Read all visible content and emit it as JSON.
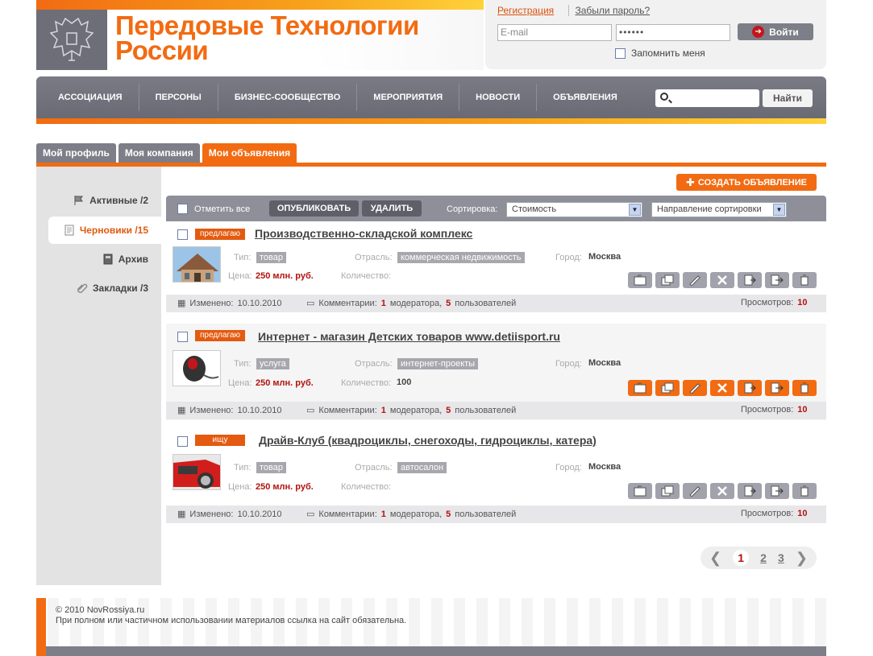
{
  "brand": {
    "logo_text": "Передовые Технологии России"
  },
  "login": {
    "register": "Регистрация",
    "forgot": "Забыли пароль?",
    "email_placeholder": "E-mail",
    "password_value": "••••••",
    "submit": "Войти",
    "remember": "Запомнить меня"
  },
  "nav": {
    "items": [
      "АССОЦИАЦИЯ",
      "ПЕРСОНЫ",
      "БИЗНЕС-СООБЩЕСТВО",
      "МЕРОПРИЯТИЯ",
      "НОВОСТИ",
      "ОБЪЯВЛЕНИЯ"
    ],
    "search_button": "Найти"
  },
  "tabs": [
    "Мой профиль",
    "Моя компания",
    "Мои объявления"
  ],
  "sidebar": [
    {
      "label": "Активные /2",
      "icon": "flag-icon"
    },
    {
      "label": "Черновики /15",
      "icon": "notepad-icon"
    },
    {
      "label": "Архив",
      "icon": "book-icon"
    },
    {
      "label": "Закладки /3",
      "icon": "paperclip-icon"
    }
  ],
  "toolbar": {
    "create": "СОЗДАТЬ ОБЪЯВЛЕНИЕ",
    "mark_all": "Отметить все",
    "publish": "ОПУБЛИКОВАТЬ",
    "delete": "УДАЛИТЬ",
    "sort_label": "Сортировка:",
    "sort_value": "Стоимость",
    "direction_value": "Направление сортировки"
  },
  "labels": {
    "type": "Тип:",
    "industry": "Отрасль:",
    "city": "Город:",
    "price": "Цена:",
    "quantity": "Количество:",
    "changed": "Изменено:",
    "comments": "Комментарии:",
    "moderator": "модератора,",
    "users": "пользователей",
    "views": "Просмотров:"
  },
  "ads": [
    {
      "badge": "предлагаю",
      "title": "Производственно-складской комплекс",
      "type": "товар",
      "industry": "коммерческая недвижимость",
      "city": "Москва",
      "price": "250 млн. руб.",
      "quantity": "",
      "changed": "10.10.2010",
      "comments_moderator": "1",
      "comments_users": "5",
      "views": "10",
      "image": "building"
    },
    {
      "badge": "предлагаю",
      "title": "Интернет - магазин Детских товаров www.detiisport.ru",
      "type": "услуга",
      "industry": "интернет-проекты",
      "city": "Москва",
      "price": "250 млн. руб.",
      "quantity": "100",
      "changed": "10.10.2010",
      "comments_moderator": "1",
      "comments_users": "5",
      "views": "10",
      "image": "mouse"
    },
    {
      "badge": "ищу",
      "title": "Драйв-Клуб (квадроциклы, снегоходы, гидроциклы, катера)",
      "type": "товар",
      "industry": "автосалон",
      "city": "Москва",
      "price": "250 млн. руб.",
      "quantity": "",
      "changed": "10.10.2010",
      "comments_moderator": "1",
      "comments_users": "5",
      "views": "10",
      "image": "car"
    }
  ],
  "pager": {
    "current": "1",
    "pages": [
      "2",
      "3"
    ]
  },
  "footer": {
    "copyright": "© 2010 NovRossiya.ru",
    "note": "При полном или частичном использовании материалов ссылка на сайт обязательна."
  },
  "colors": {
    "accent": "#f26b12",
    "nav": "#7a7b85",
    "price": "#b3120f"
  }
}
